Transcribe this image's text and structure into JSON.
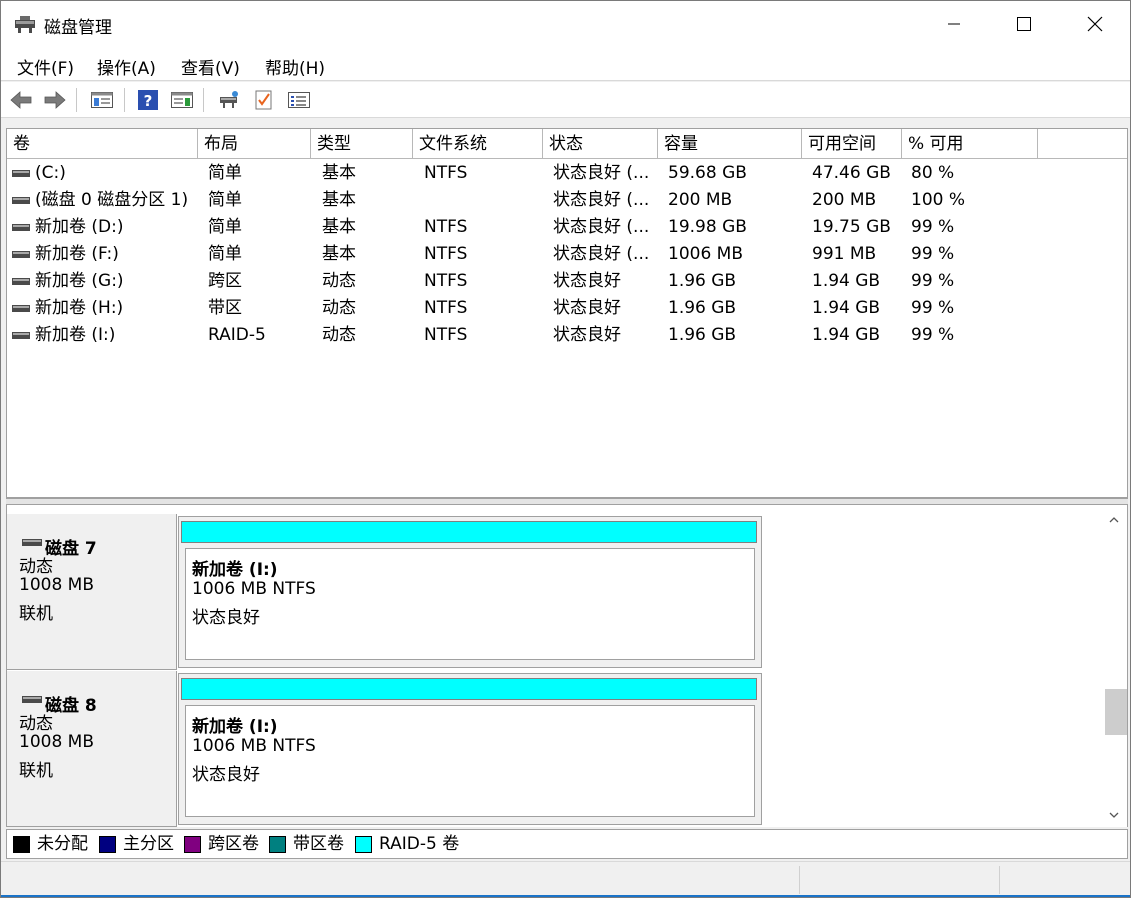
{
  "window": {
    "title": "磁盘管理"
  },
  "menu": [
    "文件(F)",
    "操作(A)",
    "查看(V)",
    "帮助(H)"
  ],
  "toolbar": {
    "icons": [
      "back-arrow-icon",
      "forward-arrow-icon",
      "console-tree-icon",
      "help-icon",
      "action-pane-icon",
      "rescan-disks-icon",
      "check-icon",
      "properties-icon"
    ]
  },
  "volumes": {
    "columns": [
      "卷",
      "布局",
      "类型",
      "文件系统",
      "状态",
      "容量",
      "可用空间",
      "% 可用"
    ],
    "rows": [
      {
        "name": " (C:)",
        "layout": "简单",
        "type": "基本",
        "fs": "NTFS",
        "status": "状态良好 (...",
        "capacity": "59.68 GB",
        "free": "47.46 GB",
        "pct": "80 %"
      },
      {
        "name": "(磁盘 0 磁盘分区 1)",
        "layout": "简单",
        "type": "基本",
        "fs": "",
        "status": "状态良好 (...",
        "capacity": "200 MB",
        "free": "200 MB",
        "pct": "100 %"
      },
      {
        "name": "新加卷 (D:)",
        "layout": "简单",
        "type": "基本",
        "fs": "NTFS",
        "status": "状态良好 (...",
        "capacity": "19.98 GB",
        "free": "19.75 GB",
        "pct": "99 %"
      },
      {
        "name": "新加卷 (F:)",
        "layout": "简单",
        "type": "基本",
        "fs": "NTFS",
        "status": "状态良好 (...",
        "capacity": "1006 MB",
        "free": "991 MB",
        "pct": "99 %"
      },
      {
        "name": "新加卷 (G:)",
        "layout": "跨区",
        "type": "动态",
        "fs": "NTFS",
        "status": "状态良好",
        "capacity": "1.96 GB",
        "free": "1.94 GB",
        "pct": "99 %"
      },
      {
        "name": "新加卷 (H:)",
        "layout": "带区",
        "type": "动态",
        "fs": "NTFS",
        "status": "状态良好",
        "capacity": "1.96 GB",
        "free": "1.94 GB",
        "pct": "99 %"
      },
      {
        "name": "新加卷 (I:)",
        "layout": "RAID-5",
        "type": "动态",
        "fs": "NTFS",
        "status": "状态良好",
        "capacity": "1.96 GB",
        "free": "1.94 GB",
        "pct": "99 %"
      }
    ]
  },
  "disks": [
    {
      "name": "磁盘 7",
      "kind": "动态",
      "size": "1008 MB",
      "state": "联机",
      "partition": {
        "title": "新加卷  (I:)",
        "detail": "1006 MB NTFS",
        "status": "状态良好",
        "color": "#00ffff"
      }
    },
    {
      "name": "磁盘 8",
      "kind": "动态",
      "size": "1008 MB",
      "state": "联机",
      "partition": {
        "title": "新加卷  (I:)",
        "detail": "1006 MB NTFS",
        "status": "状态良好",
        "color": "#00ffff"
      }
    }
  ],
  "legend": [
    {
      "label": "未分配",
      "color": "#000000"
    },
    {
      "label": "主分区",
      "color": "#000080"
    },
    {
      "label": "跨区卷",
      "color": "#800080"
    },
    {
      "label": "带区卷",
      "color": "#008080"
    },
    {
      "label": "RAID-5 卷",
      "color": "#00ffff"
    }
  ]
}
